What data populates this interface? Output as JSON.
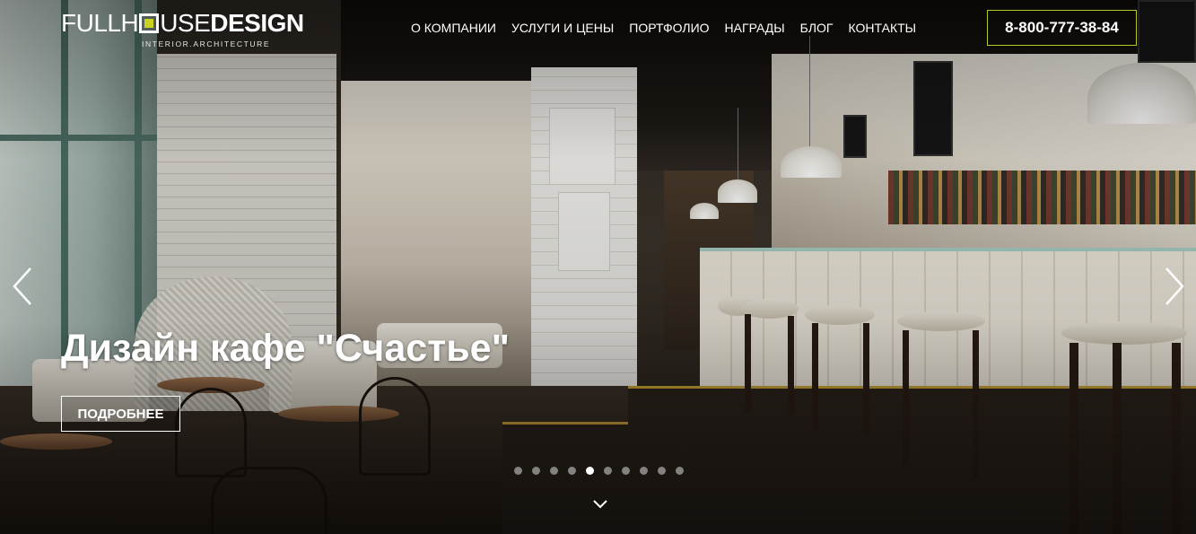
{
  "logo": {
    "part_thin_1": "FULLH",
    "part_thin_2": "USE",
    "part_bold": "DESIGN",
    "subtitle": "INTERIOR.ARCHITECTURE",
    "accent_color": "#c9d320"
  },
  "nav": {
    "items": [
      {
        "label": "О КОМПАНИИ"
      },
      {
        "label": "УСЛУГИ И ЦЕНЫ"
      },
      {
        "label": "ПОРТФОЛИО"
      },
      {
        "label": "НАГРАДЫ"
      },
      {
        "label": "БЛОГ"
      },
      {
        "label": "КОНТАКТЫ"
      }
    ]
  },
  "phone": {
    "number": "8-800-777-38-84",
    "border_color": "#b9c92c"
  },
  "slider": {
    "title": "Дизайн кафе \"Счастье\"",
    "button_label": "ПОДРОБНЕЕ",
    "slide_count": 10,
    "active_index": 4,
    "prev_icon": "chevron-left-icon",
    "next_icon": "chevron-right-icon",
    "scroll_icon": "chevron-down-icon"
  }
}
